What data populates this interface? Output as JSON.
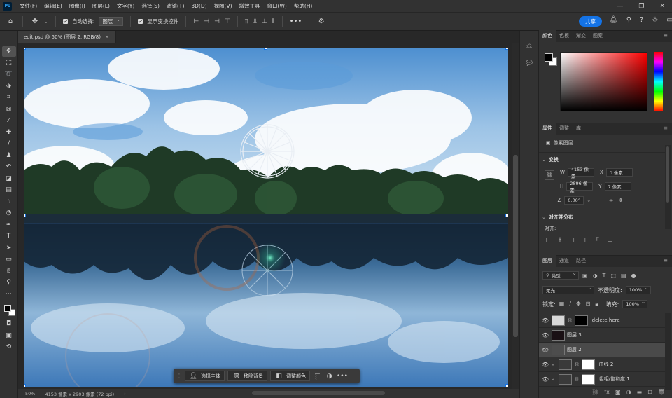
{
  "app": {
    "logo": "Ps"
  },
  "menu": [
    "文件(F)",
    "编辑(E)",
    "图像(I)",
    "图层(L)",
    "文字(Y)",
    "选择(S)",
    "滤镜(T)",
    "3D(D)",
    "视图(V)",
    "增效工具",
    "窗口(W)",
    "帮助(H)"
  ],
  "window_controls": {
    "minimize": "—",
    "maximize": "❐",
    "close": "✕"
  },
  "options_bar": {
    "auto_select_label": "自动选择:",
    "auto_select_value": "图层",
    "show_transform_label": "显示变换控件",
    "more": "•••",
    "share_label": "共享"
  },
  "document": {
    "tab_title": "edit.psd @ 50% (图层 2, RGB/8)",
    "close": "✕",
    "zoom": "50%",
    "info": "4153 像素 x 2903 像素 (72 ppi)"
  },
  "context_bar": {
    "select_subject": "选择主体",
    "remove_bg": "移除背景",
    "adjust_color": "调整颜色",
    "more": "•••"
  },
  "color_panel": {
    "tabs": [
      "颜色",
      "色板",
      "渐变",
      "图案"
    ],
    "active_tab": 0,
    "foreground": "#000000",
    "background": "#ffffff",
    "hue_color": "#ff0000"
  },
  "properties": {
    "tabs": [
      "属性",
      "调整",
      "库"
    ],
    "layer_type": "像素图层",
    "transform_title": "变换",
    "w_label": "W",
    "w_value": "4153 像素",
    "h_label": "H",
    "h_value": "2896 像素",
    "x_label": "X",
    "x_value": "0 像素",
    "y_label": "Y",
    "y_value": "7 像素",
    "angle_value": "0.00°",
    "align_title": "对齐并分布",
    "align_label": "对齐:"
  },
  "layers_panel": {
    "tabs": [
      "图层",
      "通道",
      "路径"
    ],
    "filter_kind": "类型",
    "blend_mode": "柔光",
    "opacity_label": "不透明度:",
    "opacity_value": "100%",
    "lock_label": "锁定:",
    "fill_label": "填充:",
    "fill_value": "100%",
    "layers": [
      {
        "name": "delete here",
        "visible": true,
        "selected": false,
        "thumb": "#d8d8d8",
        "mask": "#000000"
      },
      {
        "name": "图层 3",
        "visible": true,
        "selected": false,
        "thumb": "#1a1014"
      },
      {
        "name": "图层 2",
        "visible": true,
        "selected": true,
        "thumb": "#4d4d4d"
      },
      {
        "name": "曲线 2",
        "visible": true,
        "selected": false,
        "thumb": "#3a3a3a",
        "mask": "#ffffff",
        "adjustment": true
      },
      {
        "name": "色相/饱和度 1",
        "visible": true,
        "selected": false,
        "thumb": "#3a3a3a",
        "mask": "#ffffff",
        "adjustment": true
      }
    ],
    "footer_icons": [
      "link-icon",
      "fx-icon",
      "mask-icon",
      "adjustment-icon",
      "group-icon",
      "new-layer-icon",
      "trash-icon"
    ]
  }
}
